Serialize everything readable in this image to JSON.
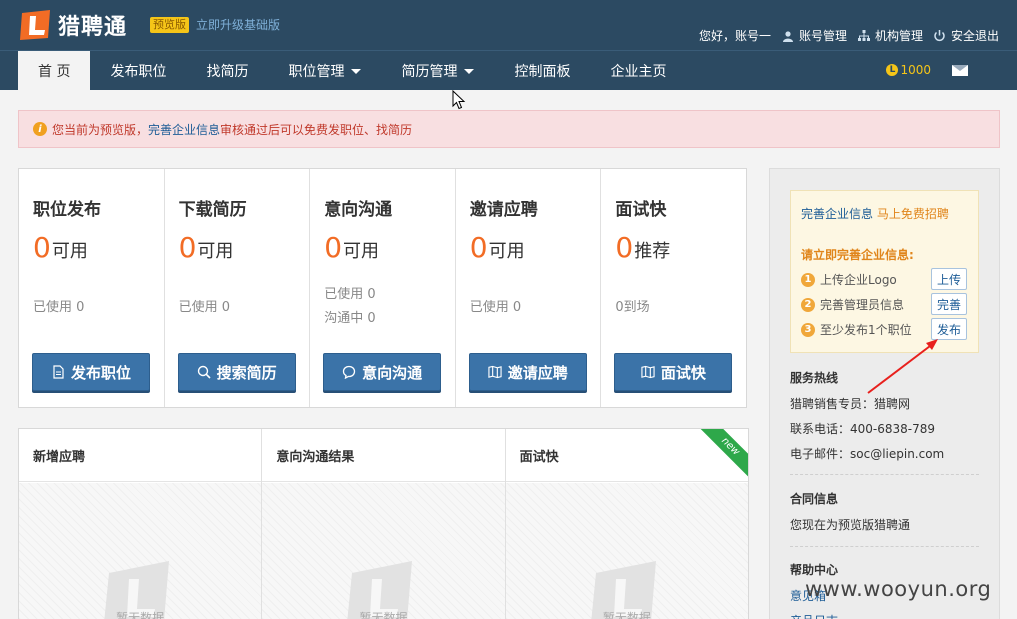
{
  "header": {
    "brand": "猎聘通",
    "preview_badge": "预览版",
    "upgrade_link": "立即升级基础版",
    "greeting": "您好，账号一",
    "account_mgmt": "账号管理",
    "org_mgmt": "机构管理",
    "logout": "安全退出"
  },
  "nav": {
    "items": [
      {
        "label": "首 页"
      },
      {
        "label": "发布职位"
      },
      {
        "label": "找简历"
      },
      {
        "label": "职位管理"
      },
      {
        "label": "简历管理"
      },
      {
        "label": "控制面板"
      },
      {
        "label": "企业主页"
      }
    ],
    "coins": "1000",
    "coin_symbol": "L"
  },
  "alert": {
    "prefix": "您当前为预览版，",
    "link": "完善企业信息",
    "suffix": "审核通过后可以免费发职位、找简历"
  },
  "stats": [
    {
      "title": "职位发布",
      "num": "0",
      "unit": "可用",
      "sub1": "已使用 0",
      "sub2": "",
      "button": "发布职位"
    },
    {
      "title": "下载简历",
      "num": "0",
      "unit": "可用",
      "sub1": "已使用 0",
      "sub2": "",
      "button": "搜索简历"
    },
    {
      "title": "意向沟通",
      "num": "0",
      "unit": "可用",
      "sub1": "已使用 0",
      "sub2": "沟通中 0",
      "button": "意向沟通"
    },
    {
      "title": "邀请应聘",
      "num": "0",
      "unit": "可用",
      "sub1": "已使用 0",
      "sub2": "",
      "button": "邀请应聘"
    },
    {
      "title": "面试快",
      "num": "0",
      "unit": "推荐",
      "sub1": "0到场",
      "sub2": "",
      "button": "面试快"
    }
  ],
  "panels": [
    {
      "title": "新增应聘",
      "empty": "暂无数据"
    },
    {
      "title": "意向沟通结果",
      "empty": "暂无数据"
    },
    {
      "title": "面试快",
      "empty": "暂无数据",
      "ribbon": "new"
    }
  ],
  "sidebar": {
    "card_link": "完善企业信息",
    "card_highlight": "马上免费招聘",
    "card_sub": "请立即完善企业信息:",
    "steps": [
      {
        "num": "1",
        "label": "上传企业Logo",
        "button": "上传"
      },
      {
        "num": "2",
        "label": "完善管理员信息",
        "button": "完善"
      },
      {
        "num": "3",
        "label": "至少发布1个职位",
        "button": "发布"
      }
    ],
    "hotline_title": "服务热线",
    "sales": "猎聘销售专员：猎聘网",
    "phone": "联系电话：400-6838-789",
    "email": "电子邮件：soc@liepin.com",
    "contract_title": "合同信息",
    "contract_text": "您现在为预览版猎聘通",
    "help_title": "帮助中心",
    "help_link1": "意见箱",
    "help_link2": "产品日志"
  },
  "watermark": "www.wooyun.org",
  "colors": {
    "header_bg": "#2c4a62",
    "accent_orange": "#f26c25",
    "button_blue": "#3b73a8",
    "alert_bg": "#f8dfe1",
    "ribbon_green": "#2ea84a"
  }
}
